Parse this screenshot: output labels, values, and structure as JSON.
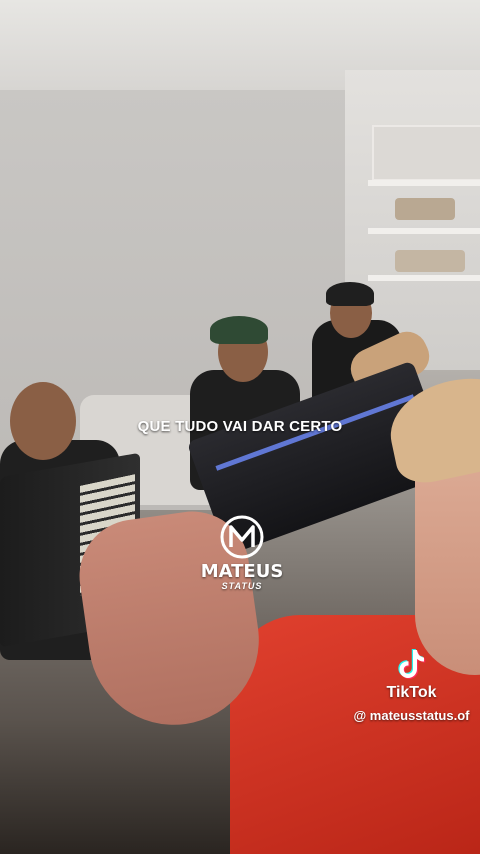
{
  "video": {
    "caption": "QUE TUDO VAI DAR CERTO"
  },
  "watermark": {
    "brand_name": "MATEUS",
    "brand_sub": "STATUS",
    "logo_icon": "m-monogram-icon"
  },
  "tiktok": {
    "icon": "tiktok-note-icon",
    "brand": "TikTok",
    "username": "@ mateusstatus.of"
  },
  "colors": {
    "caption_text": "#ffffff",
    "shirt": "#d23a27",
    "keyboard_light": "#6f8cff"
  }
}
